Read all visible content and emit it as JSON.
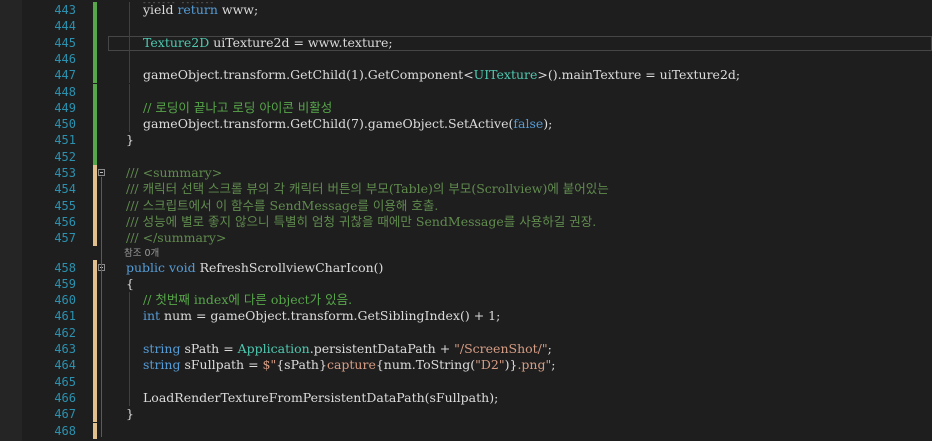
{
  "editor": {
    "theme_colors": {
      "background": "#1e1e1e",
      "line_number": "#2b91af",
      "change_saved": "#57a64a",
      "change_unsaved": "#e2c08d"
    },
    "lines": [
      {
        "num": "443",
        "bar": "saved",
        "indent": 2,
        "tokens": [
          [
            "plain",
            "yield "
          ],
          [
            "kw",
            "return"
          ],
          [
            "plain",
            " www;"
          ]
        ]
      },
      {
        "num": "444",
        "bar": "saved",
        "indent": 2,
        "tokens": []
      },
      {
        "num": "445",
        "bar": "saved",
        "indent": 2,
        "tokens": [
          [
            "type",
            "Texture2D"
          ],
          [
            "plain",
            " uiTexture2d = www.texture;"
          ]
        ],
        "current": true
      },
      {
        "num": "446",
        "bar": "saved",
        "indent": 2,
        "tokens": []
      },
      {
        "num": "447",
        "bar": "saved",
        "indent": 2,
        "tokens": [
          [
            "plain",
            "gameObject.transform.GetChild(1).GetComponent<"
          ],
          [
            "type",
            "UITexture"
          ],
          [
            "plain",
            ">().mainTexture = uiTexture2d;"
          ]
        ]
      },
      {
        "num": "448",
        "bar": "saved",
        "indent": 2,
        "tokens": []
      },
      {
        "num": "449",
        "bar": "saved",
        "indent": 2,
        "tokens": [
          [
            "cmt",
            "// 로딩이 끝나고 로딩 아이콘 비활성"
          ]
        ]
      },
      {
        "num": "450",
        "bar": "saved",
        "indent": 2,
        "tokens": [
          [
            "plain",
            "gameObject.transform.GetChild(7).gameObject.SetActive("
          ],
          [
            "kw",
            "false"
          ],
          [
            "plain",
            ");"
          ]
        ]
      },
      {
        "num": "451",
        "bar": "saved",
        "indent": 1,
        "tokens": [
          [
            "plain",
            "}"
          ]
        ]
      },
      {
        "num": "452",
        "bar": "saved",
        "indent": 1,
        "tokens": []
      },
      {
        "num": "453",
        "bar": "unsaved",
        "indent": 1,
        "fold": true,
        "tokens": [
          [
            "doctag",
            "/// "
          ],
          [
            "doctag",
            "<summary>"
          ]
        ]
      },
      {
        "num": "454",
        "bar": "unsaved",
        "indent": 1,
        "tokens": [
          [
            "doc",
            "/// 캐릭터 선택 스크롤 뷰의 각 캐릭터 버튼의 부모(Table)의 부모(Scrollview)에 붙어있는"
          ]
        ]
      },
      {
        "num": "455",
        "bar": "unsaved",
        "indent": 1,
        "tokens": [
          [
            "doc",
            "/// 스크립트에서 이 함수를 SendMessage를 이용해 호출."
          ]
        ]
      },
      {
        "num": "456",
        "bar": "unsaved",
        "indent": 1,
        "tokens": [
          [
            "doc",
            "/// 성능에 별로 좋지 않으니 특별히 엄청 귀찮을 때에만 SendMessage를 사용하길 권장."
          ]
        ]
      },
      {
        "num": "457",
        "bar": "unsaved",
        "indent": 1,
        "tokens": [
          [
            "doctag",
            "/// </summary>"
          ]
        ]
      },
      {
        "num": "458",
        "bar": "unsaved",
        "indent": 1,
        "fold": true,
        "tokens": [
          [
            "kw",
            "public"
          ],
          [
            "plain",
            " "
          ],
          [
            "kw",
            "void"
          ],
          [
            "plain",
            " RefreshScrollviewCharIcon()"
          ]
        ],
        "ref_hint": "참조 0개"
      },
      {
        "num": "459",
        "bar": "unsaved",
        "indent": 1,
        "tokens": [
          [
            "plain",
            "{"
          ]
        ]
      },
      {
        "num": "460",
        "bar": "unsaved",
        "indent": 2,
        "tokens": [
          [
            "cmt",
            "// 첫번째 index에 다른 object가 있음."
          ]
        ]
      },
      {
        "num": "461",
        "bar": "unsaved",
        "indent": 2,
        "tokens": [
          [
            "kw",
            "int"
          ],
          [
            "plain",
            " num = gameObject.transform.GetSiblingIndex() + 1;"
          ]
        ]
      },
      {
        "num": "462",
        "bar": "unsaved",
        "indent": 2,
        "tokens": []
      },
      {
        "num": "463",
        "bar": "unsaved",
        "indent": 2,
        "tokens": [
          [
            "kw",
            "string"
          ],
          [
            "plain",
            " sPath = "
          ],
          [
            "type",
            "Application"
          ],
          [
            "plain",
            ".persistentDataPath + "
          ],
          [
            "str",
            "\"/ScreenShot/\""
          ],
          [
            "plain",
            ";"
          ]
        ]
      },
      {
        "num": "464",
        "bar": "unsaved",
        "indent": 2,
        "tokens": [
          [
            "kw",
            "string"
          ],
          [
            "plain",
            " sFullpath = "
          ],
          [
            "str",
            "$\""
          ],
          [
            "plain",
            "{sPath}"
          ],
          [
            "str",
            "capture"
          ],
          [
            "plain",
            "{num.ToString("
          ],
          [
            "str",
            "\"D2\""
          ],
          [
            "plain",
            ")}"
          ],
          [
            "str",
            ".png\""
          ],
          [
            "plain",
            ";"
          ]
        ]
      },
      {
        "num": "465",
        "bar": "unsaved",
        "indent": 2,
        "tokens": []
      },
      {
        "num": "466",
        "bar": "unsaved",
        "indent": 2,
        "tokens": [
          [
            "plain",
            "LoadRenderTextureFromPersistentDataPath(sFullpath);"
          ]
        ]
      },
      {
        "num": "467",
        "bar": "unsaved",
        "indent": 1,
        "tokens": [
          [
            "plain",
            "}"
          ]
        ]
      },
      {
        "num": "468",
        "bar": "unsaved",
        "indent": 1,
        "tokens": []
      }
    ]
  }
}
